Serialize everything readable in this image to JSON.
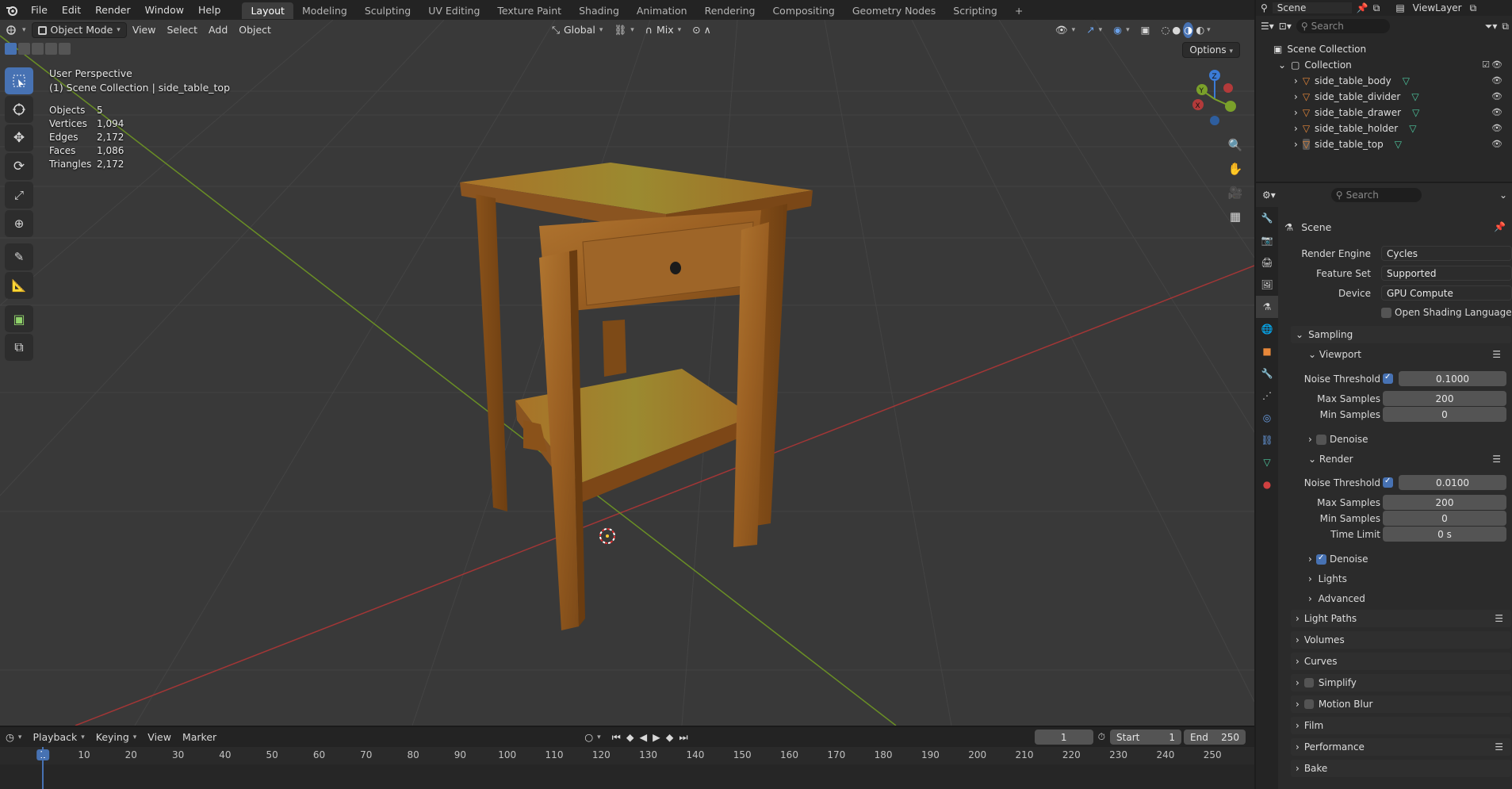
{
  "menu": {
    "items": [
      "File",
      "Edit",
      "Render",
      "Window",
      "Help"
    ]
  },
  "workspaces": [
    "Layout",
    "Modeling",
    "Sculpting",
    "UV Editing",
    "Texture Paint",
    "Shading",
    "Animation",
    "Rendering",
    "Compositing",
    "Geometry Nodes",
    "Scripting"
  ],
  "workspace_add": "+",
  "scene_selector": {
    "scene": "Scene",
    "viewlayer": "ViewLayer"
  },
  "viewport": {
    "mode": "Object Mode",
    "menus": [
      "View",
      "Select",
      "Add",
      "Object"
    ],
    "transform": "Global",
    "pivot": "Mix",
    "options": "Options",
    "perspective": "User Perspective",
    "context": "(1) Scene Collection | side_table_top",
    "stats": [
      {
        "label": "Objects",
        "value": "5"
      },
      {
        "label": "Vertices",
        "value": "1,094"
      },
      {
        "label": "Edges",
        "value": "2,172"
      },
      {
        "label": "Faces",
        "value": "1,086"
      },
      {
        "label": "Triangles",
        "value": "2,172"
      }
    ]
  },
  "timeline": {
    "menus": [
      "Playback",
      "Keying",
      "View",
      "Marker"
    ],
    "current_frame": "1",
    "start_label": "Start",
    "start": "1",
    "end_label": "End",
    "end": "250",
    "ticks": [
      "1",
      "10",
      "20",
      "30",
      "40",
      "50",
      "60",
      "70",
      "80",
      "90",
      "100",
      "110",
      "120",
      "130",
      "140",
      "150",
      "160",
      "170",
      "180",
      "190",
      "200",
      "210",
      "220",
      "230",
      "240",
      "250"
    ]
  },
  "outliner": {
    "search_placeholder": "Search",
    "root": "Scene Collection",
    "collection": "Collection",
    "items": [
      "side_table_body",
      "side_table_divider",
      "side_table_drawer",
      "side_table_holder",
      "side_table_top"
    ]
  },
  "properties": {
    "search_placeholder": "Search",
    "title": "Scene",
    "render_engine_label": "Render Engine",
    "render_engine": "Cycles",
    "feature_set_label": "Feature Set",
    "feature_set": "Supported",
    "device_label": "Device",
    "device": "GPU Compute",
    "osl_label": "Open Shading Language",
    "sampling": "Sampling",
    "viewport": "Viewport",
    "noise_threshold_label": "Noise Threshold",
    "vp_noise": "0.1000",
    "max_samples_label": "Max Samples",
    "vp_max": "200",
    "min_samples_label": "Min Samples",
    "vp_min": "0",
    "denoise": "Denoise",
    "render": "Render",
    "r_noise": "0.0100",
    "r_max": "200",
    "r_min": "0",
    "time_limit_label": "Time Limit",
    "r_time": "0 s",
    "lights": "Lights",
    "advanced": "Advanced",
    "panels": [
      "Light Paths",
      "Volumes",
      "Curves",
      "Simplify",
      "Motion Blur",
      "Film",
      "Performance",
      "Bake"
    ]
  },
  "colors": {
    "accent": "#4772b3",
    "x_axis": "#b33a3a",
    "y_axis": "#7aa02a",
    "z_axis": "#3b7bd6",
    "mesh_icon": "#e8883a",
    "data_icon": "#4ec9a0"
  }
}
